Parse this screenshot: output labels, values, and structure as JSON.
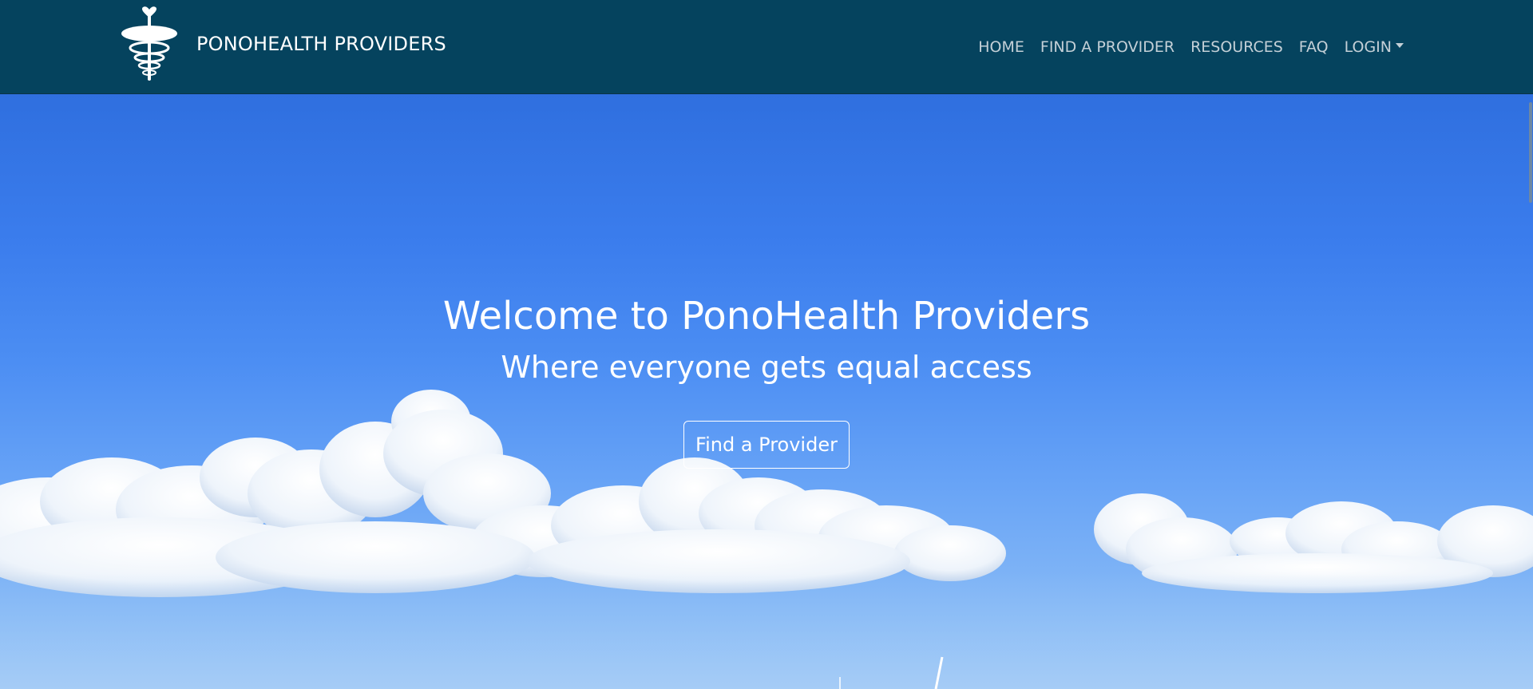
{
  "brand": {
    "name": "PONOHEALTH PROVIDERS",
    "logo_icon": "caduceus-heart-icon"
  },
  "nav": {
    "items": [
      {
        "label": "HOME"
      },
      {
        "label": "FIND A PROVIDER"
      },
      {
        "label": "RESOURCES"
      },
      {
        "label": "FAQ"
      },
      {
        "label": "LOGIN",
        "dropdown": true
      }
    ]
  },
  "hero": {
    "title": "Welcome to PonoHealth Providers",
    "subtitle": "Where everyone gets equal access",
    "button_label": "Find a Provider",
    "background": "sky-with-clouds"
  },
  "colors": {
    "navbar_bg": "#05435e",
    "nav_link": "#c4d0d7",
    "hero_text": "#ffffff",
    "sky_top": "#2f6fdf",
    "sky_bottom": "#8ec0f7"
  }
}
